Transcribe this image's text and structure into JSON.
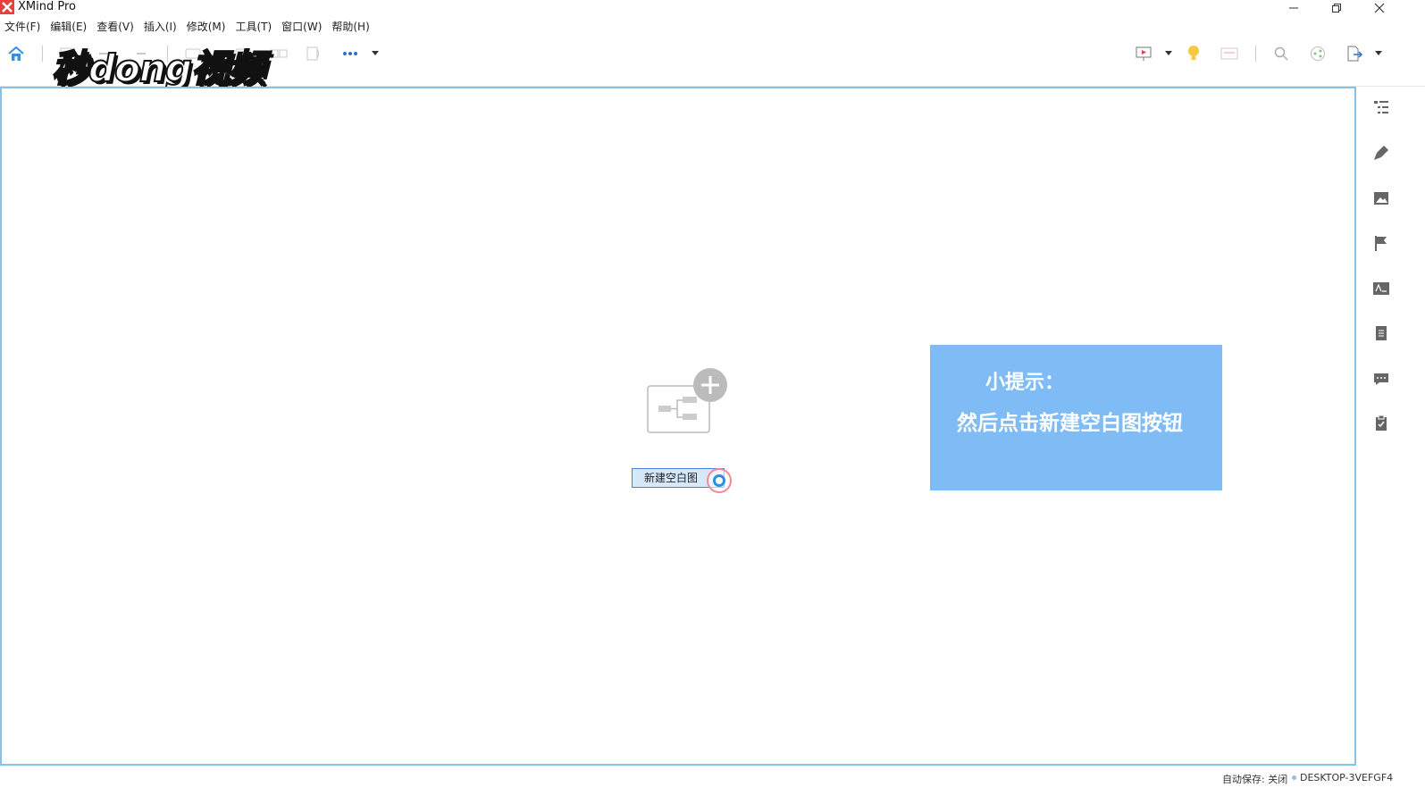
{
  "app": {
    "title": "XMind Pro"
  },
  "menu": [
    "文件(F)",
    "编辑(E)",
    "查看(V)",
    "插入(I)",
    "修改(M)",
    "工具(T)",
    "窗口(W)",
    "帮助(H)"
  ],
  "watermark": {
    "text": "秒dong视频"
  },
  "canvas": {
    "new_blank_label": "新建空白图"
  },
  "tip": {
    "title": "小提示：",
    "body": "然后点击新建空白图按钮"
  },
  "status": {
    "autosave": "自动保存: 关闭",
    "machine": "DESKTOP-3VEFGF4"
  },
  "colors": {
    "accent": "#3f86d6",
    "tip_bg": "#7fbcf6",
    "canvas_border": "#86c3ea",
    "logo": "#e8403a"
  }
}
